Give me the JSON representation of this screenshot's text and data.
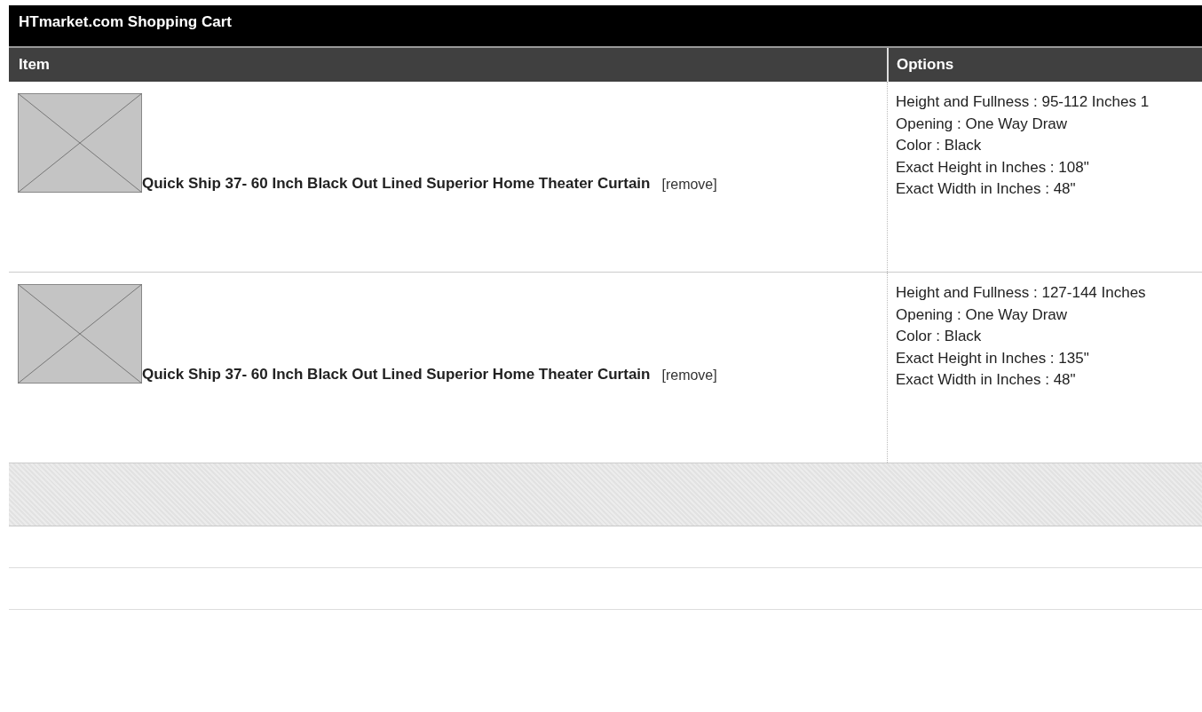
{
  "cart": {
    "title": "HTmarket.com Shopping Cart",
    "columns": [
      "Item",
      "Options"
    ],
    "items": [
      {
        "name": "Quick Ship 37- 60 Inch Black Out Lined Superior Home Theater Curtain",
        "remove": "[remove]",
        "options": [
          "Height and Fullness : 95-112 Inches 1",
          "Opening : One Way Draw",
          "Color : Black",
          "Exact Height in Inches : 108\"",
          "Exact Width in Inches : 48\""
        ]
      },
      {
        "name": "Quick Ship 37- 60 Inch Black Out Lined Superior Home Theater Curtain",
        "remove": "[remove]",
        "options": [
          "Height and Fullness : 127-144 Inches",
          "Opening : One Way Draw",
          "Color : Black",
          "Exact Height in Inches : 135\"",
          "Exact Width in Inches : 48\""
        ]
      }
    ]
  }
}
